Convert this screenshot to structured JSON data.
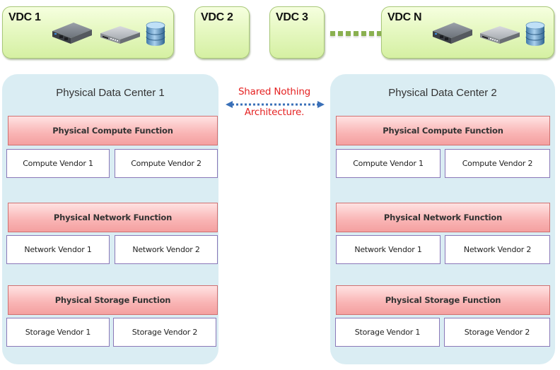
{
  "vdcs": [
    {
      "label": "VDC 1",
      "icons": [
        "server-icon",
        "network-switch-icon",
        "database-icon"
      ]
    },
    {
      "label": "VDC 2",
      "icons": []
    },
    {
      "label": "VDC 3",
      "icons": []
    },
    {
      "label": "VDC N",
      "icons": [
        "server-icon",
        "network-switch-icon",
        "database-icon"
      ]
    }
  ],
  "ellipsis_connector": "dotted-line",
  "shared": {
    "line1": "Shared Nothing",
    "line2": "Architecture.",
    "arrow": "double-headed-dotted-arrow"
  },
  "data_centers": [
    {
      "title": "Physical Data Center 1",
      "functions": [
        {
          "name": "Physical Compute Function",
          "vendors": [
            "Compute Vendor 1",
            "Compute Vendor 2"
          ]
        },
        {
          "name": "Physical Network Function",
          "vendors": [
            "Network Vendor 1",
            "Network Vendor 2"
          ]
        },
        {
          "name": "Physical Storage Function",
          "vendors": [
            "Storage Vendor 1",
            "Storage Vendor 2"
          ]
        }
      ]
    },
    {
      "title": "Physical Data Center 2",
      "functions": [
        {
          "name": "Physical Compute Function",
          "vendors": [
            "Compute Vendor 1",
            "Compute Vendor 2"
          ]
        },
        {
          "name": "Physical Network Function",
          "vendors": [
            "Network Vendor 1",
            "Network Vendor 2"
          ]
        },
        {
          "name": "Physical Storage Function",
          "vendors": [
            "Storage Vendor 1",
            "Storage Vendor 2"
          ]
        }
      ]
    }
  ],
  "colors": {
    "vdc_fill": "#e6f8c2",
    "pdc_fill": "#daedf3",
    "function_fill": "#f9b4b4",
    "vendor_border": "#8a78b8",
    "shared_text": "#e52222",
    "arrow": "#3a70b8"
  }
}
